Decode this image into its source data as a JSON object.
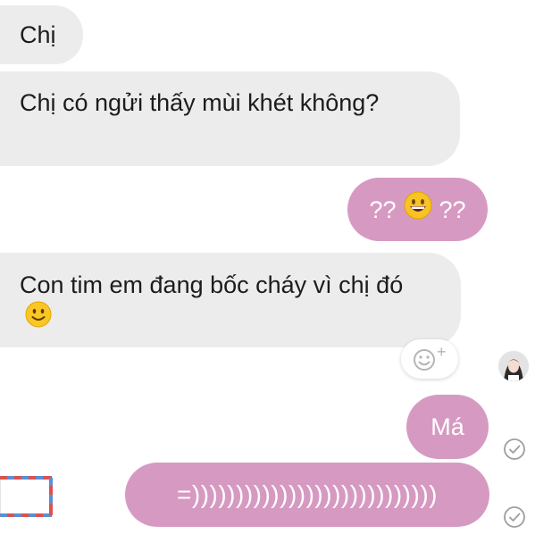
{
  "messages": [
    {
      "side": "incoming",
      "text": "Chị"
    },
    {
      "side": "incoming",
      "text": "Chị có ngửi thấy mùi khét không?"
    },
    {
      "side": "outgoing",
      "text_before": "??",
      "emoji": "grinning-face",
      "text_after": "??"
    },
    {
      "side": "incoming",
      "text": "Con tim em đang bốc cháy vì chị đó",
      "emoji": "slightly-smiling-face"
    },
    {
      "side": "outgoing",
      "text": "Má"
    },
    {
      "side": "outgoing",
      "text": "=))))))))))))))))))))))))))))"
    }
  ],
  "reaction": {
    "icon": "add-reaction-icon",
    "plus": "+"
  },
  "colors": {
    "incoming_bubble": "#ececec",
    "outgoing_bubble": "#d69ac2",
    "seen_check": "#9e9e9e"
  }
}
